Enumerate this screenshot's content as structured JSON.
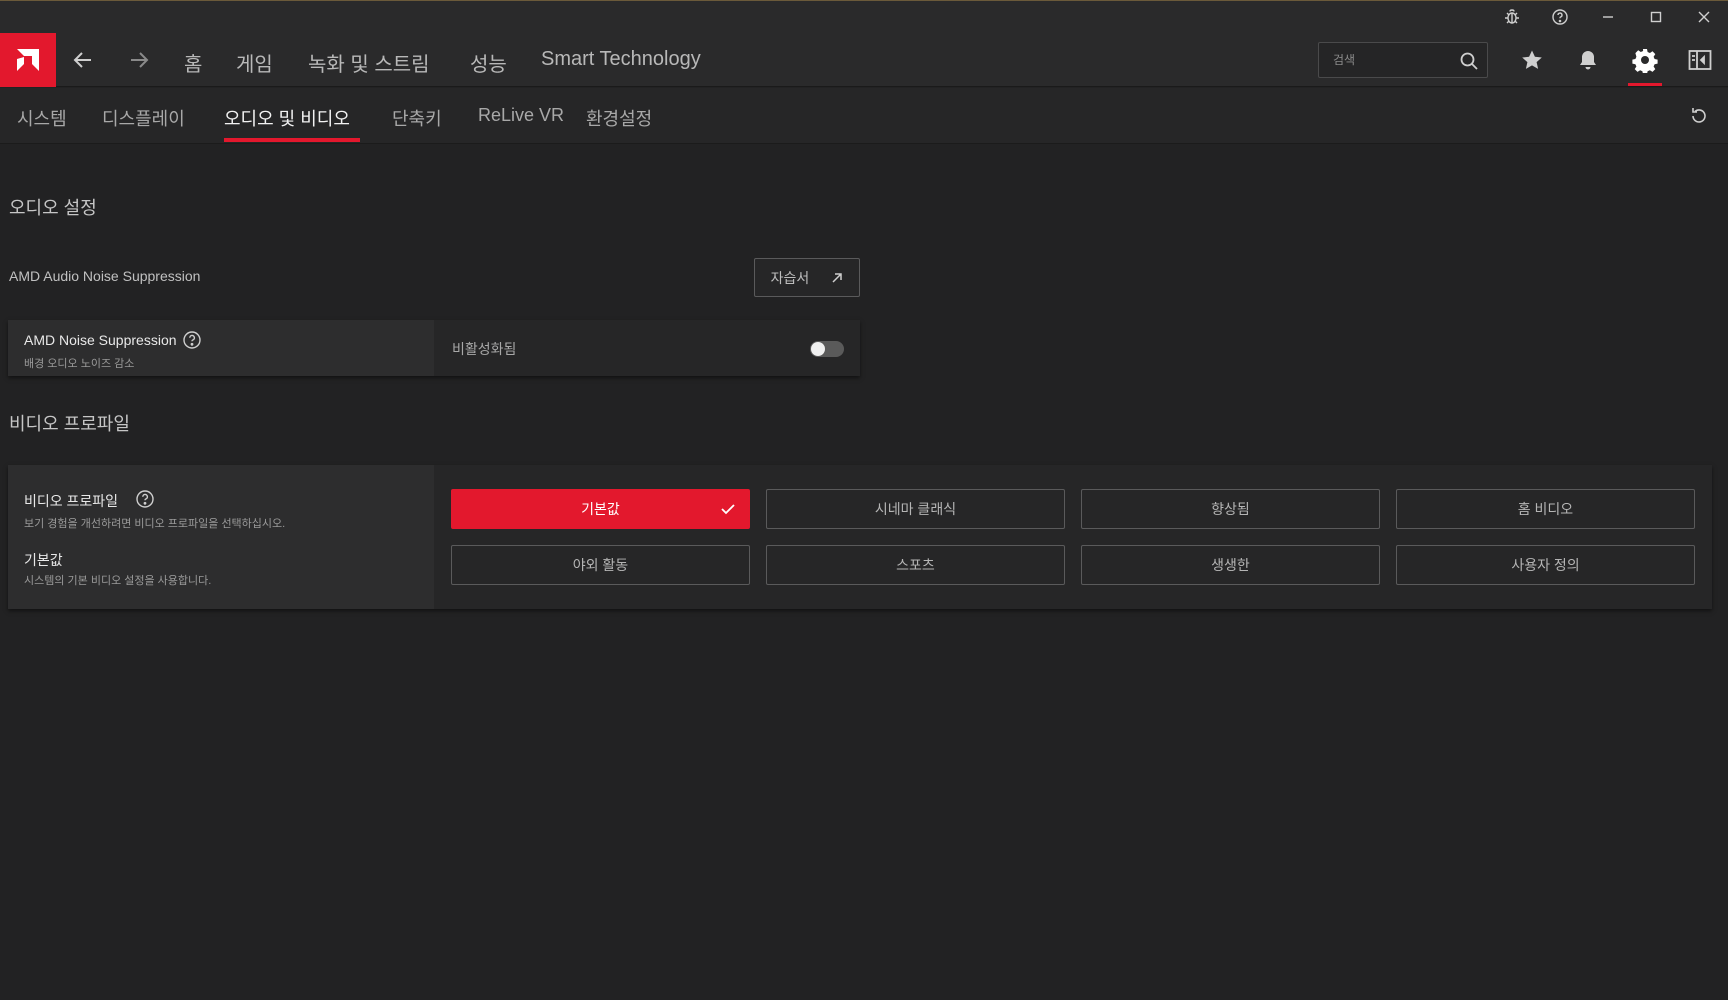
{
  "window": {
    "title_buttons": [
      {
        "name": "bug-report-icon"
      },
      {
        "name": "help-icon"
      },
      {
        "name": "minimize-icon"
      },
      {
        "name": "maximize-icon"
      },
      {
        "name": "close-icon"
      }
    ]
  },
  "topnav": {
    "logo": "amd-logo",
    "items": [
      {
        "label": "홈"
      },
      {
        "label": "게임"
      },
      {
        "label": "녹화 및 스트림"
      },
      {
        "label": "성능"
      },
      {
        "label": "Smart Technology"
      }
    ],
    "search": {
      "placeholder": "검색",
      "value": ""
    },
    "tools": [
      {
        "name": "favorites-star-icon"
      },
      {
        "name": "notifications-bell-icon"
      },
      {
        "name": "settings-gear-icon"
      },
      {
        "name": "sidebar-panel-icon"
      }
    ]
  },
  "tabs": [
    {
      "label": "시스템"
    },
    {
      "label": "디스플레이"
    },
    {
      "label": "오디오 및 비디오",
      "active": true
    },
    {
      "label": "단축키"
    },
    {
      "label": "ReLive VR"
    },
    {
      "label": "환경설정"
    }
  ],
  "audio": {
    "section_title": "오디오 설정",
    "feature_label": "AMD Audio Noise Suppression",
    "manual_button": "자습서",
    "noise": {
      "title": "AMD Noise Suppression",
      "desc": "배경 오디오 노이즈 감소",
      "state_label": "비활성화됨",
      "enabled": false
    }
  },
  "video": {
    "section_title": "비디오 프로파일",
    "title": "비디오 프로파일",
    "desc": "보기 경험을 개선하려면 비디오 프로파일을 선택하십시오.",
    "current_title": "기본값",
    "current_desc": "시스템의 기본 비디오 설정을 사용합니다.",
    "profiles": [
      {
        "label": "기본값",
        "selected": true
      },
      {
        "label": "시네마 클래식"
      },
      {
        "label": "향상됨"
      },
      {
        "label": "홈 비디오"
      },
      {
        "label": "야외 활동"
      },
      {
        "label": "스포츠"
      },
      {
        "label": "생생한"
      },
      {
        "label": "사용자 정의"
      }
    ]
  },
  "colors": {
    "accent": "#e3182d",
    "background": "#222223",
    "panel": "#262627"
  }
}
